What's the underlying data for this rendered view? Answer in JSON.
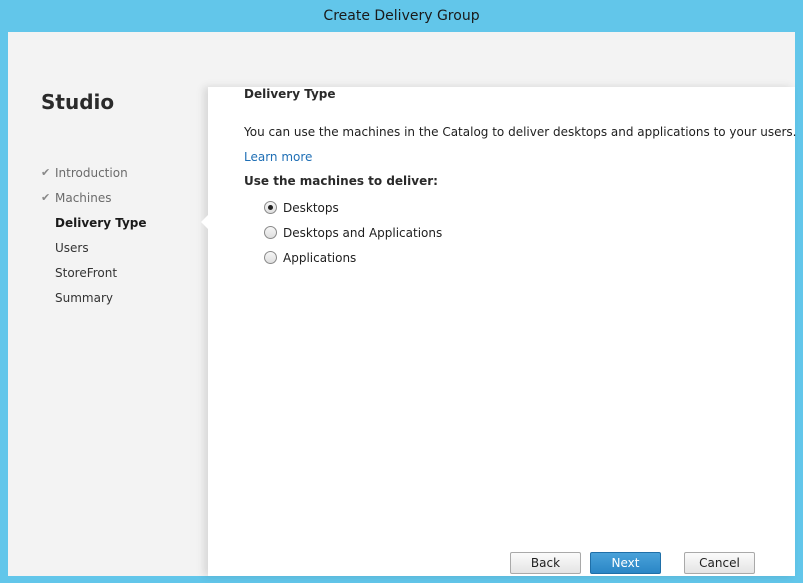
{
  "window": {
    "title": "Create Delivery Group"
  },
  "sidebar": {
    "brand": "Studio",
    "steps": [
      {
        "label": "Introduction",
        "state": "done"
      },
      {
        "label": "Machines",
        "state": "done"
      },
      {
        "label": "Delivery Type",
        "state": "active"
      },
      {
        "label": "Users",
        "state": "pending"
      },
      {
        "label": "StoreFront",
        "state": "pending"
      },
      {
        "label": "Summary",
        "state": "pending"
      }
    ]
  },
  "main": {
    "title": "Delivery Type",
    "description": "You can use the machines in the Catalog to deliver desktops and applications to your users.",
    "learn_more": "Learn more",
    "deliver_label": "Use the machines to deliver:",
    "options": [
      {
        "label": "Desktops",
        "selected": true
      },
      {
        "label": "Desktops and Applications",
        "selected": false
      },
      {
        "label": "Applications",
        "selected": false
      }
    ]
  },
  "buttons": {
    "back": "Back",
    "next": "Next",
    "cancel": "Cancel"
  },
  "colors": {
    "frame": "#62c6ea",
    "primary_button": "#2a86c6",
    "link": "#1f6fb5"
  },
  "icons": {
    "completed_step": "checkmark-icon"
  }
}
